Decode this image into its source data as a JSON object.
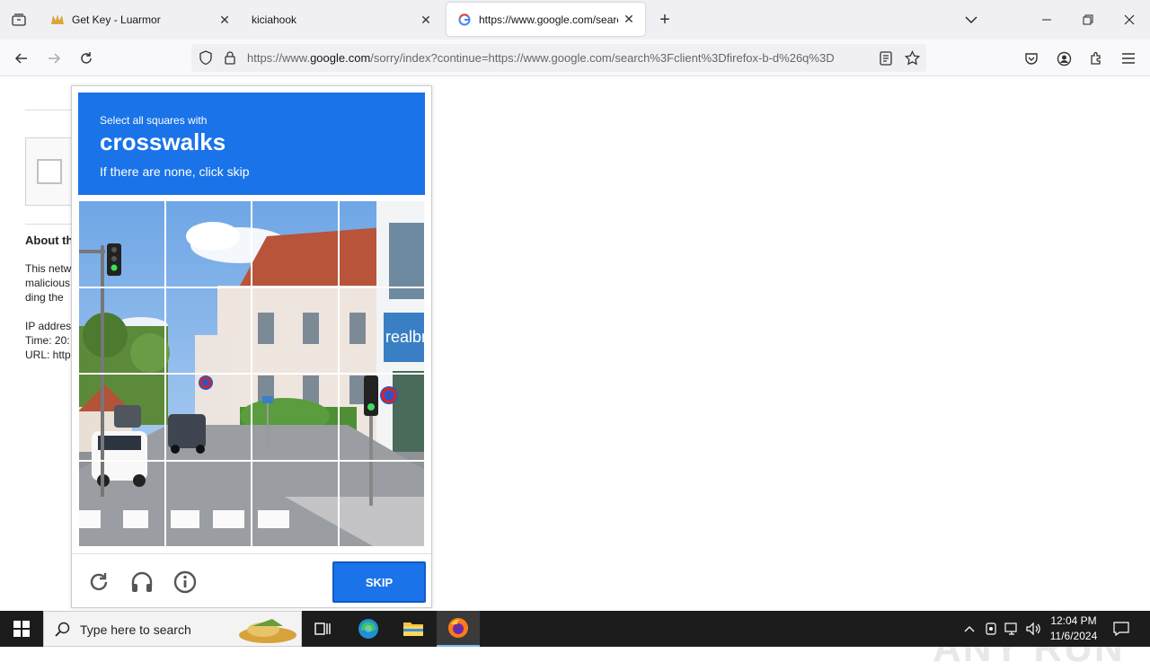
{
  "browser": {
    "tabs": [
      {
        "title": "Get Key - Luarmor",
        "active": false
      },
      {
        "title": "kiciahook",
        "active": false
      },
      {
        "title": "https://www.google.com/search",
        "active": true
      }
    ],
    "url_prefix": "https://www.",
    "url_domain": "google.com",
    "url_rest": "/sorry/index?continue=https://www.google.com/search%3Fclient%3Dfirefox-b-d%26q%3D"
  },
  "background_page": {
    "heading": "About th",
    "lines": [
      "This netw",
      "malicious",
      "ding the",
      "",
      "IP addres",
      "Time: 20:",
      "URL: http"
    ]
  },
  "captcha": {
    "instruction": "Select all squares with",
    "target": "crosswalks",
    "hint": "If there are none, click skip",
    "skip_label": "SKIP"
  },
  "watermark": "ANY RUN",
  "taskbar": {
    "search_placeholder": "Type here to search",
    "time": "12:04 PM",
    "date": "11/6/2024"
  },
  "colors": {
    "captcha_blue": "#1a73e8",
    "taskbar": "#1c1c1c"
  }
}
